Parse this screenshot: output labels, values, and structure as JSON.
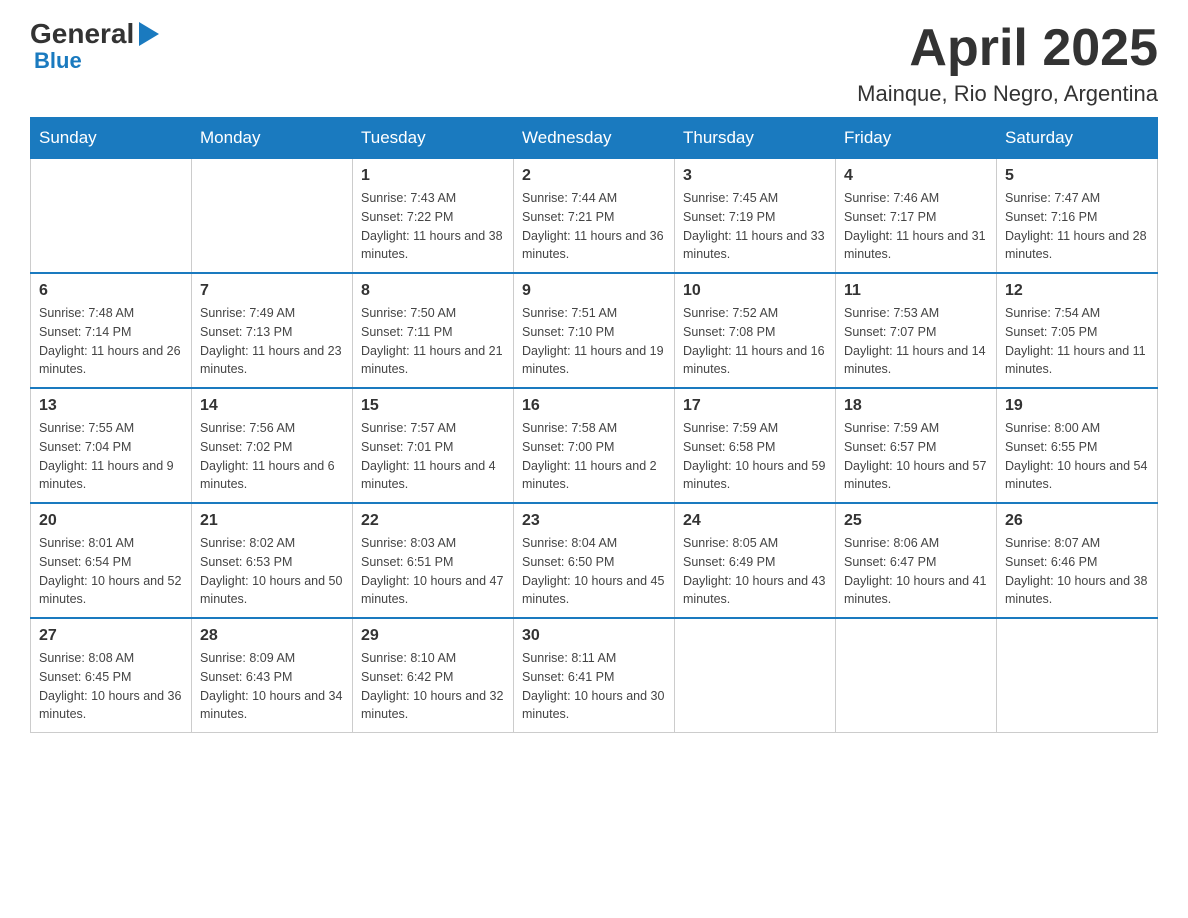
{
  "header": {
    "title": "April 2025",
    "location": "Mainque, Rio Negro, Argentina",
    "logo": {
      "general": "General",
      "blue": "Blue"
    }
  },
  "weekdays": [
    "Sunday",
    "Monday",
    "Tuesday",
    "Wednesday",
    "Thursday",
    "Friday",
    "Saturday"
  ],
  "weeks": [
    [
      {
        "day": "",
        "sunrise": "",
        "sunset": "",
        "daylight": ""
      },
      {
        "day": "",
        "sunrise": "",
        "sunset": "",
        "daylight": ""
      },
      {
        "day": "1",
        "sunrise": "Sunrise: 7:43 AM",
        "sunset": "Sunset: 7:22 PM",
        "daylight": "Daylight: 11 hours and 38 minutes."
      },
      {
        "day": "2",
        "sunrise": "Sunrise: 7:44 AM",
        "sunset": "Sunset: 7:21 PM",
        "daylight": "Daylight: 11 hours and 36 minutes."
      },
      {
        "day": "3",
        "sunrise": "Sunrise: 7:45 AM",
        "sunset": "Sunset: 7:19 PM",
        "daylight": "Daylight: 11 hours and 33 minutes."
      },
      {
        "day": "4",
        "sunrise": "Sunrise: 7:46 AM",
        "sunset": "Sunset: 7:17 PM",
        "daylight": "Daylight: 11 hours and 31 minutes."
      },
      {
        "day": "5",
        "sunrise": "Sunrise: 7:47 AM",
        "sunset": "Sunset: 7:16 PM",
        "daylight": "Daylight: 11 hours and 28 minutes."
      }
    ],
    [
      {
        "day": "6",
        "sunrise": "Sunrise: 7:48 AM",
        "sunset": "Sunset: 7:14 PM",
        "daylight": "Daylight: 11 hours and 26 minutes."
      },
      {
        "day": "7",
        "sunrise": "Sunrise: 7:49 AM",
        "sunset": "Sunset: 7:13 PM",
        "daylight": "Daylight: 11 hours and 23 minutes."
      },
      {
        "day": "8",
        "sunrise": "Sunrise: 7:50 AM",
        "sunset": "Sunset: 7:11 PM",
        "daylight": "Daylight: 11 hours and 21 minutes."
      },
      {
        "day": "9",
        "sunrise": "Sunrise: 7:51 AM",
        "sunset": "Sunset: 7:10 PM",
        "daylight": "Daylight: 11 hours and 19 minutes."
      },
      {
        "day": "10",
        "sunrise": "Sunrise: 7:52 AM",
        "sunset": "Sunset: 7:08 PM",
        "daylight": "Daylight: 11 hours and 16 minutes."
      },
      {
        "day": "11",
        "sunrise": "Sunrise: 7:53 AM",
        "sunset": "Sunset: 7:07 PM",
        "daylight": "Daylight: 11 hours and 14 minutes."
      },
      {
        "day": "12",
        "sunrise": "Sunrise: 7:54 AM",
        "sunset": "Sunset: 7:05 PM",
        "daylight": "Daylight: 11 hours and 11 minutes."
      }
    ],
    [
      {
        "day": "13",
        "sunrise": "Sunrise: 7:55 AM",
        "sunset": "Sunset: 7:04 PM",
        "daylight": "Daylight: 11 hours and 9 minutes."
      },
      {
        "day": "14",
        "sunrise": "Sunrise: 7:56 AM",
        "sunset": "Sunset: 7:02 PM",
        "daylight": "Daylight: 11 hours and 6 minutes."
      },
      {
        "day": "15",
        "sunrise": "Sunrise: 7:57 AM",
        "sunset": "Sunset: 7:01 PM",
        "daylight": "Daylight: 11 hours and 4 minutes."
      },
      {
        "day": "16",
        "sunrise": "Sunrise: 7:58 AM",
        "sunset": "Sunset: 7:00 PM",
        "daylight": "Daylight: 11 hours and 2 minutes."
      },
      {
        "day": "17",
        "sunrise": "Sunrise: 7:59 AM",
        "sunset": "Sunset: 6:58 PM",
        "daylight": "Daylight: 10 hours and 59 minutes."
      },
      {
        "day": "18",
        "sunrise": "Sunrise: 7:59 AM",
        "sunset": "Sunset: 6:57 PM",
        "daylight": "Daylight: 10 hours and 57 minutes."
      },
      {
        "day": "19",
        "sunrise": "Sunrise: 8:00 AM",
        "sunset": "Sunset: 6:55 PM",
        "daylight": "Daylight: 10 hours and 54 minutes."
      }
    ],
    [
      {
        "day": "20",
        "sunrise": "Sunrise: 8:01 AM",
        "sunset": "Sunset: 6:54 PM",
        "daylight": "Daylight: 10 hours and 52 minutes."
      },
      {
        "day": "21",
        "sunrise": "Sunrise: 8:02 AM",
        "sunset": "Sunset: 6:53 PM",
        "daylight": "Daylight: 10 hours and 50 minutes."
      },
      {
        "day": "22",
        "sunrise": "Sunrise: 8:03 AM",
        "sunset": "Sunset: 6:51 PM",
        "daylight": "Daylight: 10 hours and 47 minutes."
      },
      {
        "day": "23",
        "sunrise": "Sunrise: 8:04 AM",
        "sunset": "Sunset: 6:50 PM",
        "daylight": "Daylight: 10 hours and 45 minutes."
      },
      {
        "day": "24",
        "sunrise": "Sunrise: 8:05 AM",
        "sunset": "Sunset: 6:49 PM",
        "daylight": "Daylight: 10 hours and 43 minutes."
      },
      {
        "day": "25",
        "sunrise": "Sunrise: 8:06 AM",
        "sunset": "Sunset: 6:47 PM",
        "daylight": "Daylight: 10 hours and 41 minutes."
      },
      {
        "day": "26",
        "sunrise": "Sunrise: 8:07 AM",
        "sunset": "Sunset: 6:46 PM",
        "daylight": "Daylight: 10 hours and 38 minutes."
      }
    ],
    [
      {
        "day": "27",
        "sunrise": "Sunrise: 8:08 AM",
        "sunset": "Sunset: 6:45 PM",
        "daylight": "Daylight: 10 hours and 36 minutes."
      },
      {
        "day": "28",
        "sunrise": "Sunrise: 8:09 AM",
        "sunset": "Sunset: 6:43 PM",
        "daylight": "Daylight: 10 hours and 34 minutes."
      },
      {
        "day": "29",
        "sunrise": "Sunrise: 8:10 AM",
        "sunset": "Sunset: 6:42 PM",
        "daylight": "Daylight: 10 hours and 32 minutes."
      },
      {
        "day": "30",
        "sunrise": "Sunrise: 8:11 AM",
        "sunset": "Sunset: 6:41 PM",
        "daylight": "Daylight: 10 hours and 30 minutes."
      },
      {
        "day": "",
        "sunrise": "",
        "sunset": "",
        "daylight": ""
      },
      {
        "day": "",
        "sunrise": "",
        "sunset": "",
        "daylight": ""
      },
      {
        "day": "",
        "sunrise": "",
        "sunset": "",
        "daylight": ""
      }
    ]
  ]
}
